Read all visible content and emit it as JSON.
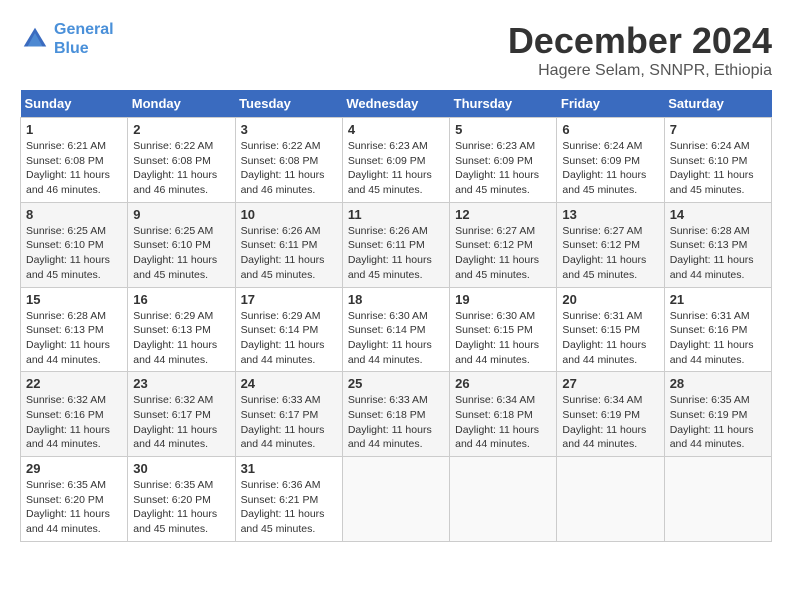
{
  "header": {
    "logo_line1": "General",
    "logo_line2": "Blue",
    "month_title": "December 2024",
    "location": "Hagere Selam, SNNPR, Ethiopia"
  },
  "weekdays": [
    "Sunday",
    "Monday",
    "Tuesday",
    "Wednesday",
    "Thursday",
    "Friday",
    "Saturday"
  ],
  "weeks": [
    [
      {
        "day": 1,
        "sunrise": "6:21 AM",
        "sunset": "6:08 PM",
        "daylight": "11 hours and 46 minutes."
      },
      {
        "day": 2,
        "sunrise": "6:22 AM",
        "sunset": "6:08 PM",
        "daylight": "11 hours and 46 minutes."
      },
      {
        "day": 3,
        "sunrise": "6:22 AM",
        "sunset": "6:08 PM",
        "daylight": "11 hours and 46 minutes."
      },
      {
        "day": 4,
        "sunrise": "6:23 AM",
        "sunset": "6:09 PM",
        "daylight": "11 hours and 45 minutes."
      },
      {
        "day": 5,
        "sunrise": "6:23 AM",
        "sunset": "6:09 PM",
        "daylight": "11 hours and 45 minutes."
      },
      {
        "day": 6,
        "sunrise": "6:24 AM",
        "sunset": "6:09 PM",
        "daylight": "11 hours and 45 minutes."
      },
      {
        "day": 7,
        "sunrise": "6:24 AM",
        "sunset": "6:10 PM",
        "daylight": "11 hours and 45 minutes."
      }
    ],
    [
      {
        "day": 8,
        "sunrise": "6:25 AM",
        "sunset": "6:10 PM",
        "daylight": "11 hours and 45 minutes."
      },
      {
        "day": 9,
        "sunrise": "6:25 AM",
        "sunset": "6:10 PM",
        "daylight": "11 hours and 45 minutes."
      },
      {
        "day": 10,
        "sunrise": "6:26 AM",
        "sunset": "6:11 PM",
        "daylight": "11 hours and 45 minutes."
      },
      {
        "day": 11,
        "sunrise": "6:26 AM",
        "sunset": "6:11 PM",
        "daylight": "11 hours and 45 minutes."
      },
      {
        "day": 12,
        "sunrise": "6:27 AM",
        "sunset": "6:12 PM",
        "daylight": "11 hours and 45 minutes."
      },
      {
        "day": 13,
        "sunrise": "6:27 AM",
        "sunset": "6:12 PM",
        "daylight": "11 hours and 45 minutes."
      },
      {
        "day": 14,
        "sunrise": "6:28 AM",
        "sunset": "6:13 PM",
        "daylight": "11 hours and 44 minutes."
      }
    ],
    [
      {
        "day": 15,
        "sunrise": "6:28 AM",
        "sunset": "6:13 PM",
        "daylight": "11 hours and 44 minutes."
      },
      {
        "day": 16,
        "sunrise": "6:29 AM",
        "sunset": "6:13 PM",
        "daylight": "11 hours and 44 minutes."
      },
      {
        "day": 17,
        "sunrise": "6:29 AM",
        "sunset": "6:14 PM",
        "daylight": "11 hours and 44 minutes."
      },
      {
        "day": 18,
        "sunrise": "6:30 AM",
        "sunset": "6:14 PM",
        "daylight": "11 hours and 44 minutes."
      },
      {
        "day": 19,
        "sunrise": "6:30 AM",
        "sunset": "6:15 PM",
        "daylight": "11 hours and 44 minutes."
      },
      {
        "day": 20,
        "sunrise": "6:31 AM",
        "sunset": "6:15 PM",
        "daylight": "11 hours and 44 minutes."
      },
      {
        "day": 21,
        "sunrise": "6:31 AM",
        "sunset": "6:16 PM",
        "daylight": "11 hours and 44 minutes."
      }
    ],
    [
      {
        "day": 22,
        "sunrise": "6:32 AM",
        "sunset": "6:16 PM",
        "daylight": "11 hours and 44 minutes."
      },
      {
        "day": 23,
        "sunrise": "6:32 AM",
        "sunset": "6:17 PM",
        "daylight": "11 hours and 44 minutes."
      },
      {
        "day": 24,
        "sunrise": "6:33 AM",
        "sunset": "6:17 PM",
        "daylight": "11 hours and 44 minutes."
      },
      {
        "day": 25,
        "sunrise": "6:33 AM",
        "sunset": "6:18 PM",
        "daylight": "11 hours and 44 minutes."
      },
      {
        "day": 26,
        "sunrise": "6:34 AM",
        "sunset": "6:18 PM",
        "daylight": "11 hours and 44 minutes."
      },
      {
        "day": 27,
        "sunrise": "6:34 AM",
        "sunset": "6:19 PM",
        "daylight": "11 hours and 44 minutes."
      },
      {
        "day": 28,
        "sunrise": "6:35 AM",
        "sunset": "6:19 PM",
        "daylight": "11 hours and 44 minutes."
      }
    ],
    [
      {
        "day": 29,
        "sunrise": "6:35 AM",
        "sunset": "6:20 PM",
        "daylight": "11 hours and 44 minutes."
      },
      {
        "day": 30,
        "sunrise": "6:35 AM",
        "sunset": "6:20 PM",
        "daylight": "11 hours and 45 minutes."
      },
      {
        "day": 31,
        "sunrise": "6:36 AM",
        "sunset": "6:21 PM",
        "daylight": "11 hours and 45 minutes."
      },
      null,
      null,
      null,
      null
    ]
  ]
}
